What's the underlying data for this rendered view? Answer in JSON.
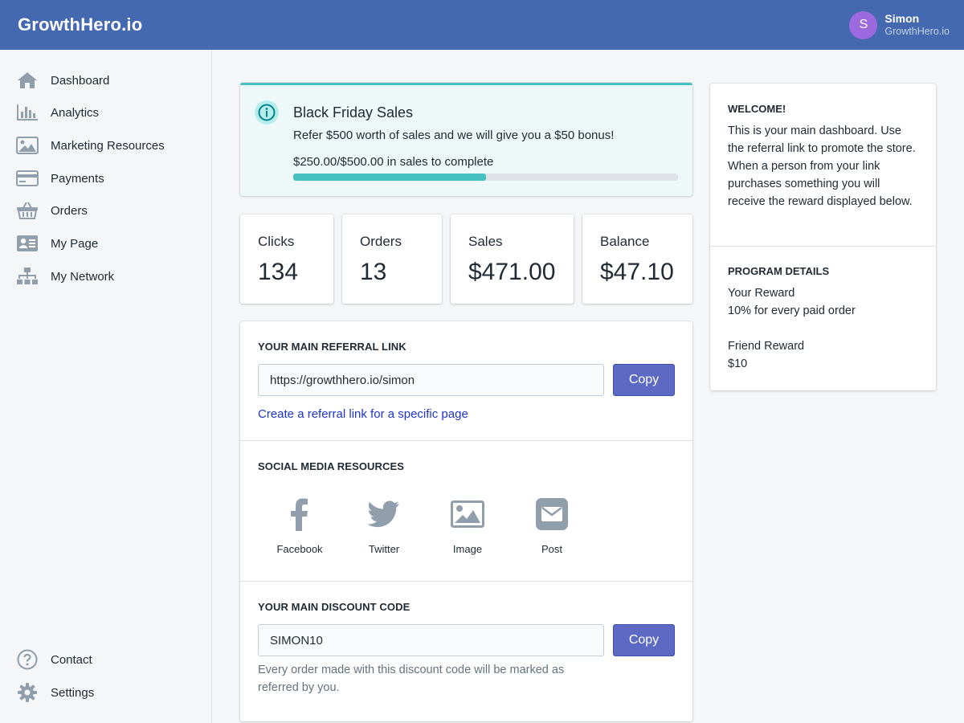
{
  "topbar": {
    "brand": "GrowthHero.io",
    "user": {
      "initial": "S",
      "name": "Simon",
      "subtitle": "GrowthHero.io"
    }
  },
  "sidebar": {
    "items": [
      {
        "label": "Dashboard",
        "icon": "home-icon"
      },
      {
        "label": "Analytics",
        "icon": "bar-chart-icon"
      },
      {
        "label": "Marketing Resources",
        "icon": "image-icon"
      },
      {
        "label": "Payments",
        "icon": "credit-card-icon"
      },
      {
        "label": "Orders",
        "icon": "basket-icon"
      },
      {
        "label": "My Page",
        "icon": "profile-card-icon"
      },
      {
        "label": "My Network",
        "icon": "sitemap-icon"
      }
    ],
    "bottom_items": [
      {
        "label": "Contact",
        "icon": "question-circle-icon"
      },
      {
        "label": "Settings",
        "icon": "gear-icon"
      }
    ]
  },
  "banner": {
    "icon": "info-icon",
    "title": "Black Friday Sales",
    "text": "Refer $500 worth of sales and we will give you a $50 bonus!",
    "progress_text": "$250.00/$500.00 in sales to complete",
    "progress_fraction": 0.5
  },
  "stats": [
    {
      "label": "Clicks",
      "value": "134"
    },
    {
      "label": "Orders",
      "value": "13"
    },
    {
      "label": "Sales",
      "value": "$471.00"
    },
    {
      "label": "Balance",
      "value": "$47.10"
    }
  ],
  "referral": {
    "title": "YOUR MAIN REFERRAL LINK",
    "link": "https://growthhero.io/simon",
    "copy_label": "Copy",
    "specific_link_label": "Create a referral link for a specific page"
  },
  "social": {
    "title": "SOCIAL MEDIA RESOURCES",
    "items": [
      {
        "label": "Facebook",
        "icon": "facebook-icon"
      },
      {
        "label": "Twitter",
        "icon": "twitter-icon"
      },
      {
        "label": "Image",
        "icon": "image-icon"
      },
      {
        "label": "Post",
        "icon": "mail-icon"
      }
    ]
  },
  "discount": {
    "title": "YOUR MAIN DISCOUNT CODE",
    "code": "SIMON10",
    "copy_label": "Copy",
    "help": "Every order made with this discount code will be marked as referred by you."
  },
  "welcome": {
    "title": "WELCOME!",
    "text": "This is your main dashboard. Use the referral link to promote the store. When a person from your link purchases something you will receive the reward displayed below."
  },
  "program": {
    "title": "PROGRAM DETAILS",
    "your_reward_label": "Your Reward",
    "your_reward_value": "10% for every paid order",
    "friend_reward_label": "Friend Reward",
    "friend_reward_value": "$10"
  },
  "colors": {
    "topbar": "#4469b0",
    "accent_button": "#5c6ac4",
    "progress": "#47c1bf",
    "avatar": "#9c6ade",
    "link": "#1f35c8"
  }
}
